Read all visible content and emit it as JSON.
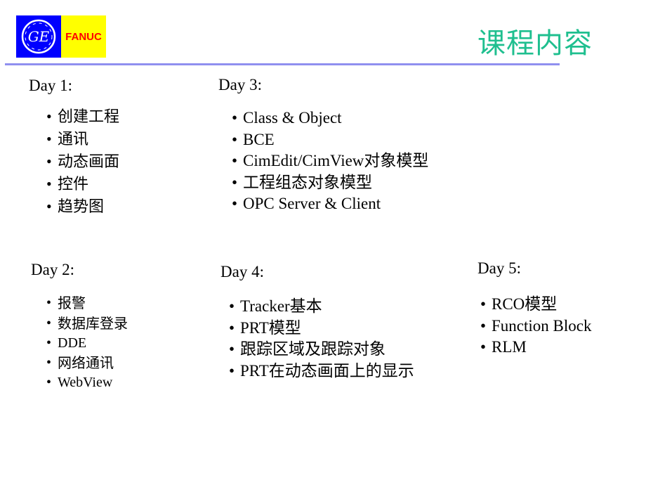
{
  "header": {
    "logo": {
      "left_mark": "GE",
      "right_text": "FANUC",
      "colors": {
        "ge_bg": "#0000ff",
        "fanuc_bg": "#ffff00",
        "fanuc_text": "#ff0000"
      }
    },
    "title": "课程内容",
    "title_color": "#1fbf8f",
    "divider_color": "#8f8fef"
  },
  "days": [
    {
      "label": "Day 1:",
      "items": [
        "创建工程",
        "通讯",
        "动态画面",
        "控件",
        "趋势图"
      ]
    },
    {
      "label": "Day 2:",
      "items": [
        "报警",
        "数据库登录",
        "DDE",
        "网络通讯",
        "WebView"
      ]
    },
    {
      "label": "Day 3:",
      "items": [
        "Class & Object",
        "BCE",
        "CimEdit/CimView对象模型",
        "工程组态对象模型",
        "OPC Server & Client"
      ]
    },
    {
      "label": "Day 4:",
      "items": [
        "Tracker基本",
        "PRT模型",
        "跟踪区域及跟踪对象",
        "PRT在动态画面上的显示"
      ]
    },
    {
      "label": "Day 5:",
      "items": [
        "RCO模型",
        "Function Block",
        "RLM"
      ]
    }
  ],
  "bullet_char": "•"
}
